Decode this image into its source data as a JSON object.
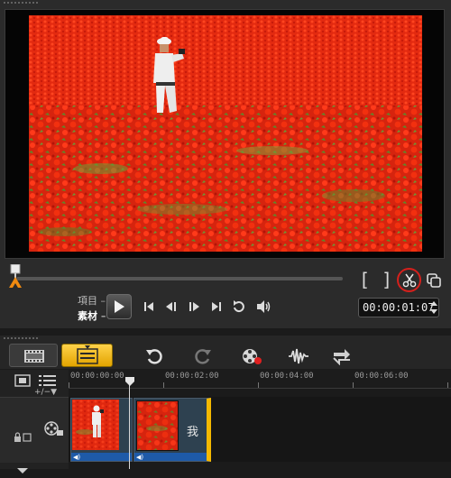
{
  "preview": {
    "mode_project": "項目",
    "mode_clip": "素材",
    "mode_dash": "–",
    "mark_in": "[",
    "mark_out": "]",
    "timecode": "00:00:01:07"
  },
  "timeline": {
    "zoom_controls": "+/−▼",
    "ruler_ticks": [
      "00:00:00:00",
      "00:00:02:00",
      "00:00:04:00",
      "00:00:06:00"
    ],
    "clips": [
      {
        "title": ""
      },
      {
        "title": "我"
      }
    ]
  },
  "colors": {
    "accent_selected": "#f5b800",
    "cut_highlight": "#d6201c",
    "audio_strip": "#1e5aa8"
  },
  "icons": {
    "play": "play-icon",
    "prev": "skip-start-icon",
    "frame_back": "frame-back-icon",
    "frame_fwd": "frame-forward-icon",
    "next": "skip-end-icon",
    "repeat": "repeat-icon",
    "volume": "volume-icon",
    "scissors": "scissors-icon",
    "overlay": "overlay-copy-icon"
  }
}
